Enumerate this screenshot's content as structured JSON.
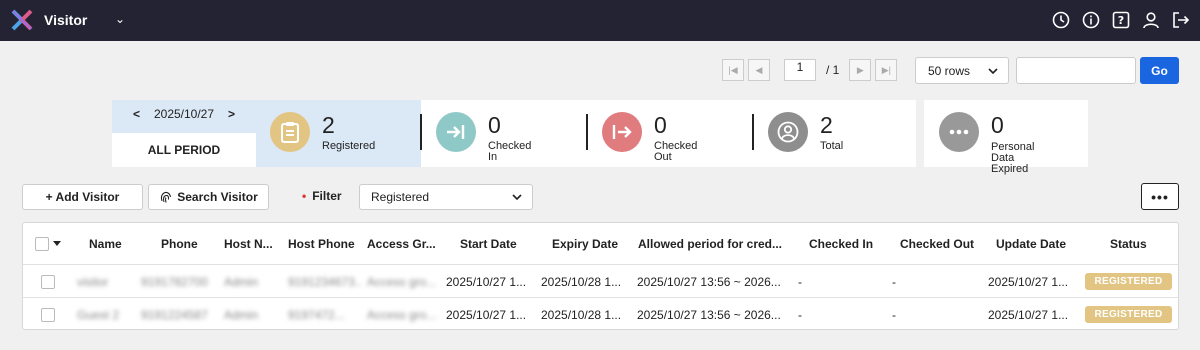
{
  "header": {
    "app_title": "Visitor",
    "icons": [
      "clock-icon",
      "info-icon",
      "help-icon",
      "user-icon",
      "logout-icon"
    ]
  },
  "pagination": {
    "current_page": "1",
    "total_label": "/ 1"
  },
  "rows_per_page": "50 rows",
  "search": {
    "value": "",
    "go_label": "Go"
  },
  "date_card": {
    "date": "2025/10/27",
    "prev": "<",
    "next": ">",
    "all_period": "ALL PERIOD"
  },
  "stats": [
    {
      "count": "2",
      "label": "Registered",
      "icon": "clipboard-icon",
      "color": "#e2c583"
    },
    {
      "count": "0",
      "label": "Checked In",
      "icon": "check-in-icon",
      "color": "#8fc9c7"
    },
    {
      "count": "0",
      "label": "Checked Out",
      "icon": "check-out-icon",
      "color": "#e07b7e"
    },
    {
      "count": "2",
      "label": "Total",
      "icon": "person-icon",
      "color": "#8e8e8e"
    },
    {
      "count": "0",
      "label_line1": "Personal Data",
      "label_line2": "Expired",
      "icon": "more-dots-icon",
      "color": "#999999"
    }
  ],
  "actions": {
    "add_visitor": "+ Add Visitor",
    "search_visitor": "Search Visitor",
    "filter_label": "Filter",
    "filter_value": "Registered",
    "more": "•••"
  },
  "table": {
    "columns": [
      "Name",
      "Phone",
      "Host N...",
      "Host Phone",
      "Access Gr...",
      "Start Date",
      "Expiry Date",
      "Allowed period for cred...",
      "Checked In",
      "Checked Out",
      "Update Date",
      "Status"
    ],
    "rows": [
      {
        "name": "visitor",
        "phone": "9191782700",
        "host_name": "Admin",
        "host_phone": "9191234673...",
        "access_group": "Access gro...",
        "start": "2025/10/27 1...",
        "expiry": "2025/10/28 1...",
        "allowed": "2025/10/27 13:56 ~ 2026...",
        "checked_in": "-",
        "checked_out": "-",
        "update": "2025/10/27 1...",
        "status": "REGISTERED"
      },
      {
        "name": "Guest 2",
        "phone": "9191224587",
        "host_name": "Admin",
        "host_phone": "9197472...",
        "access_group": "Access gro...",
        "start": "2025/10/27 1...",
        "expiry": "2025/10/28 1...",
        "allowed": "2025/10/27 13:56 ~ 2026...",
        "checked_in": "-",
        "checked_out": "-",
        "update": "2025/10/27 1...",
        "status": "REGISTERED"
      }
    ]
  },
  "colors": {
    "topbar": "#232333",
    "accent": "#1a66e0",
    "status_badge": "#e2c583"
  }
}
